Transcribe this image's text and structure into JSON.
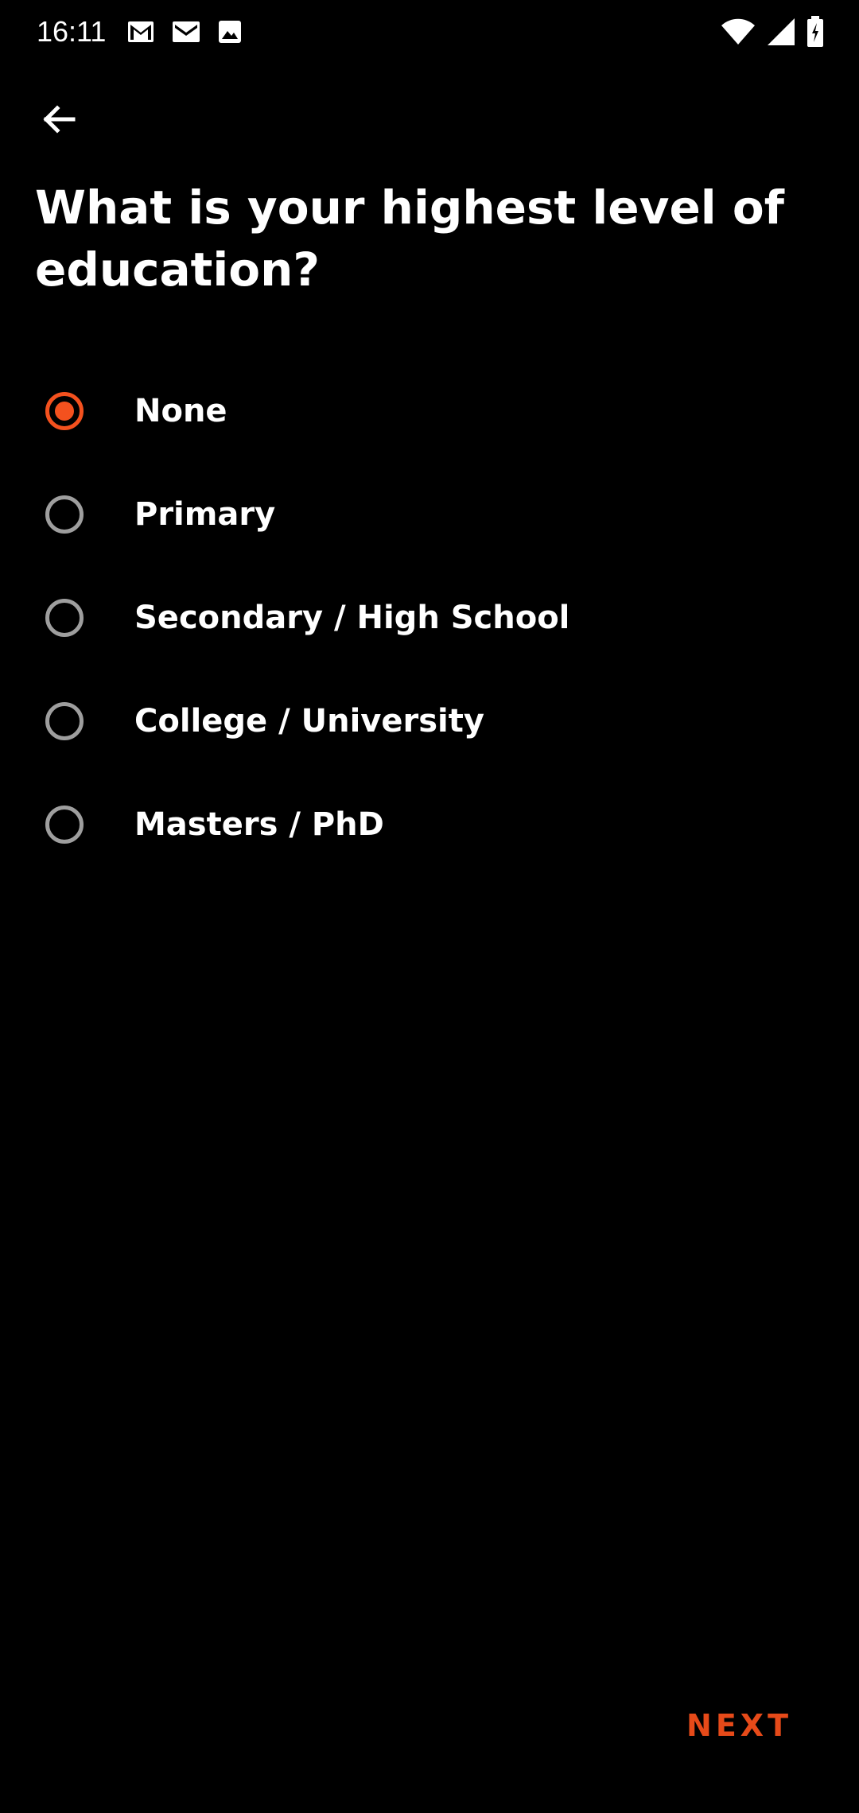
{
  "status_bar": {
    "time": "16:11",
    "left_icons": [
      "gmail-icon",
      "email-icon",
      "image-icon"
    ],
    "right_icons": [
      "wifi-icon",
      "cell-signal-icon",
      "battery-icon"
    ]
  },
  "app_bar": {
    "back_icon": "arrow-back-icon"
  },
  "question": {
    "title": "What is your highest level of education?"
  },
  "options": [
    {
      "label": "None",
      "selected": true
    },
    {
      "label": "Primary",
      "selected": false
    },
    {
      "label": "Secondary / High School",
      "selected": false
    },
    {
      "label": "College / University",
      "selected": false
    },
    {
      "label": "Masters / PhD",
      "selected": false
    }
  ],
  "footer": {
    "next_label": "NEXT"
  },
  "colors": {
    "background": "#000000",
    "accent": "#f4511e",
    "radio_unchecked": "#9e9e9e",
    "text": "#ffffff"
  }
}
